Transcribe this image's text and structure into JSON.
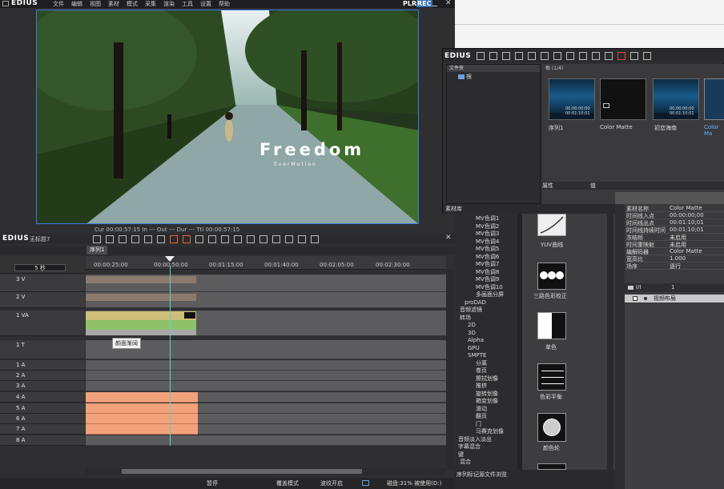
{
  "app": {
    "brand": "EDIUS",
    "menu": [
      "文件",
      "编辑",
      "视图",
      "素材",
      "模式",
      "采集",
      "渲染",
      "工具",
      "设置",
      "帮助"
    ],
    "plr": "PLR",
    "rec": "REC"
  },
  "preview": {
    "title_big": "Freedom",
    "title_small": "EverMotion",
    "timecode_partial": "Cur 00:00:57:15   In ---   Out ---   Dur ---   Ttl 00:00:57:15"
  },
  "timeline": {
    "brand": "EDIUS",
    "project": "无标题7",
    "sequence_tab": "序列1",
    "ruler": [
      "00:00:25:00",
      "00:00:50:00",
      "00:01:15:00",
      "00:01:40:00",
      "00:02:05:00",
      "00:02:30:00"
    ],
    "zoom": "5 秒",
    "tracks": [
      {
        "name": "3 V"
      },
      {
        "name": "2 V"
      },
      {
        "name": "1 VA"
      },
      {
        "name": "1 T"
      },
      {
        "name": "1 A"
      },
      {
        "name": "2 A"
      },
      {
        "name": "3 A"
      },
      {
        "name": "4 A"
      },
      {
        "name": "5 A"
      },
      {
        "name": "6 A"
      },
      {
        "name": "7 A"
      },
      {
        "name": "8 A"
      }
    ],
    "tooltip": "颜面渐阔"
  },
  "status": {
    "state": "暂停",
    "mode": "覆盖模式",
    "ripple": "波纹开启",
    "disk": "磁盘:31% 被使用(D:)"
  },
  "bin": {
    "brand": "EDIUS",
    "folder_header": "文件夹",
    "root": "根",
    "count": "根 (1/4)",
    "clips": [
      {
        "label": "序列1",
        "tc1": "00:00:00;00",
        "tc2": "00:01:10;01"
      },
      {
        "label": "Color Matte",
        "tc1": "",
        "tc2": ""
      },
      {
        "label": "初恋海南",
        "tc1": "00:00:00;00",
        "tc2": "00:01:10;01"
      },
      {
        "label": "Color Ma",
        "tc1": "",
        "tc2": ""
      }
    ],
    "prop_col1": "属性",
    "prop_col2": "值",
    "tab": "素材库"
  },
  "effects": {
    "tree": [
      "MV色调1",
      "MV色调2",
      "MV色调3",
      "MV色调4",
      "MV色调5",
      "MV色调6",
      "MV色调7",
      "MV色调8",
      "MV色调9",
      "MV色调10",
      "多画面分屏",
      "proDAD",
      "音频滤镜",
      "转场",
      "2D",
      "3D",
      "Alpha",
      "GPU",
      "SMPTE",
      "分离",
      "卷页",
      "擦拭划像",
      "推挤",
      "旋转划像",
      "箱变划像",
      "滑动",
      "翻页",
      "门",
      "马赛克划像",
      "音频淡入淡出",
      "字幕混合",
      "键",
      "混合"
    ],
    "tiles": [
      "YUV曲线",
      "三路色彩校正",
      "单色",
      "色彩平衡",
      "颜色轮"
    ],
    "tabs": [
      "序列标记",
      "源文件浏览"
    ]
  },
  "info": {
    "rows": [
      {
        "k": "素材名称",
        "v": "Color Matte"
      },
      {
        "k": "时间线入点",
        "v": "00:00:00;00"
      },
      {
        "k": "时间线出点",
        "v": "00:01:10;01"
      },
      {
        "k": "时间线持续时间",
        "v": "00:01:10;01"
      },
      {
        "k": "冻结帧",
        "v": "未启用"
      },
      {
        "k": "时间重映射",
        "v": "未启用"
      },
      {
        "k": "编解码器",
        "v": "Color Matte"
      },
      {
        "k": "宽高比",
        "v": "1.000"
      },
      {
        "k": "场序",
        "v": "逐行"
      }
    ],
    "filter_hdr1": "I/I",
    "filter_hdr2": "1",
    "filter_item": "视频布局"
  }
}
